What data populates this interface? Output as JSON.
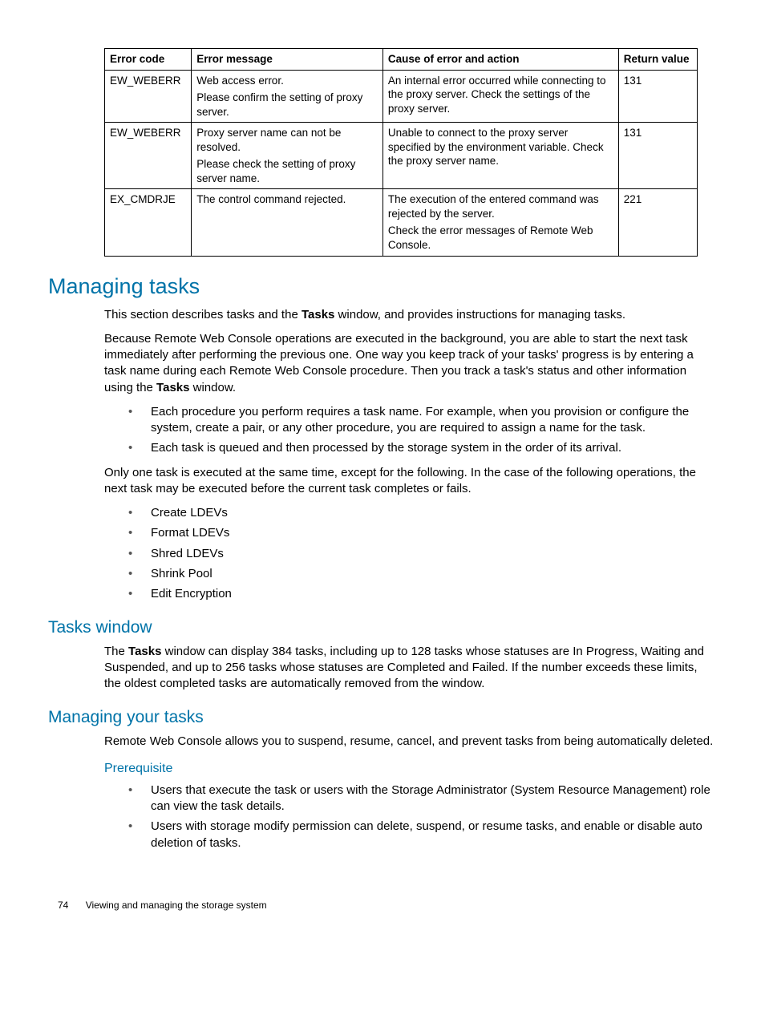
{
  "table": {
    "headers": {
      "code": "Error code",
      "msg": "Error message",
      "cause": "Cause of error and action",
      "ret": "Return value"
    },
    "rows": [
      {
        "code": "EW_WEBERR",
        "msg1": "Web access error.",
        "msg2": "Please confirm the setting of proxy server.",
        "cause": "An internal error occurred while connecting to the proxy server. Check the settings of the proxy server.",
        "ret": "131"
      },
      {
        "code": "EW_WEBERR",
        "msg1": "Proxy server name can not be resolved.",
        "msg2": "Please check the setting of proxy server name.",
        "cause": "Unable to connect to the proxy server specified by the environment variable. Check the proxy server name.",
        "ret": "131"
      },
      {
        "code": "EX_CMDRJE",
        "msg1": "The control command rejected.",
        "msg2": "",
        "cause1": "The execution of the entered command was rejected by the server.",
        "cause2": "Check the error messages of Remote Web Console.",
        "ret": "221"
      }
    ]
  },
  "h1": "Managing tasks",
  "intro1a": "This section describes tasks and the ",
  "intro1b": "Tasks",
  "intro1c": " window, and provides instructions for managing tasks.",
  "intro2a": "Because Remote Web Console operations are executed in the background, you are able to start the next task immediately after performing the previous one. One way you keep track of your tasks' progress is by entering a task name during each Remote Web Console procedure. Then you track a task's status and other information using the ",
  "intro2b": "Tasks",
  "intro2c": " window.",
  "bl1": {
    "i0": "Each procedure you perform requires a task name. For example, when you provision or configure the system, create a pair, or any other procedure, you are required to assign a name for the task.",
    "i1": "Each task is queued and then processed by the storage system in the order of its arrival."
  },
  "para3": "Only one task is executed at the same time, except for the following. In the case of the following operations, the next task may be executed before the current task completes or fails.",
  "bl2": {
    "i0": "Create LDEVs",
    "i1": "Format LDEVs",
    "i2": "Shred LDEVs",
    "i3": "Shrink Pool",
    "i4": "Edit Encryption"
  },
  "h2a": "Tasks window",
  "twin_a": "The ",
  "twin_b": "Tasks",
  "twin_c": " window can display 384 tasks, including up to 128 tasks whose statuses are In Progress, Waiting and Suspended, and up to 256 tasks whose statuses are Completed and Failed. If the number exceeds these limits, the oldest completed tasks are automatically removed from the window.",
  "h2b": "Managing your tasks",
  "myt_p": "Remote Web Console allows you to suspend, resume, cancel, and prevent tasks from being automatically deleted.",
  "h3": "Prerequisite",
  "bl3": {
    "i0": "Users that execute the task or users with the Storage Administrator (System Resource Management) role can view the task details.",
    "i1": "Users with storage modify permission can delete, suspend, or resume tasks, and enable or disable auto deletion of tasks."
  },
  "footer": {
    "page": "74",
    "title": "Viewing and managing the storage system"
  }
}
